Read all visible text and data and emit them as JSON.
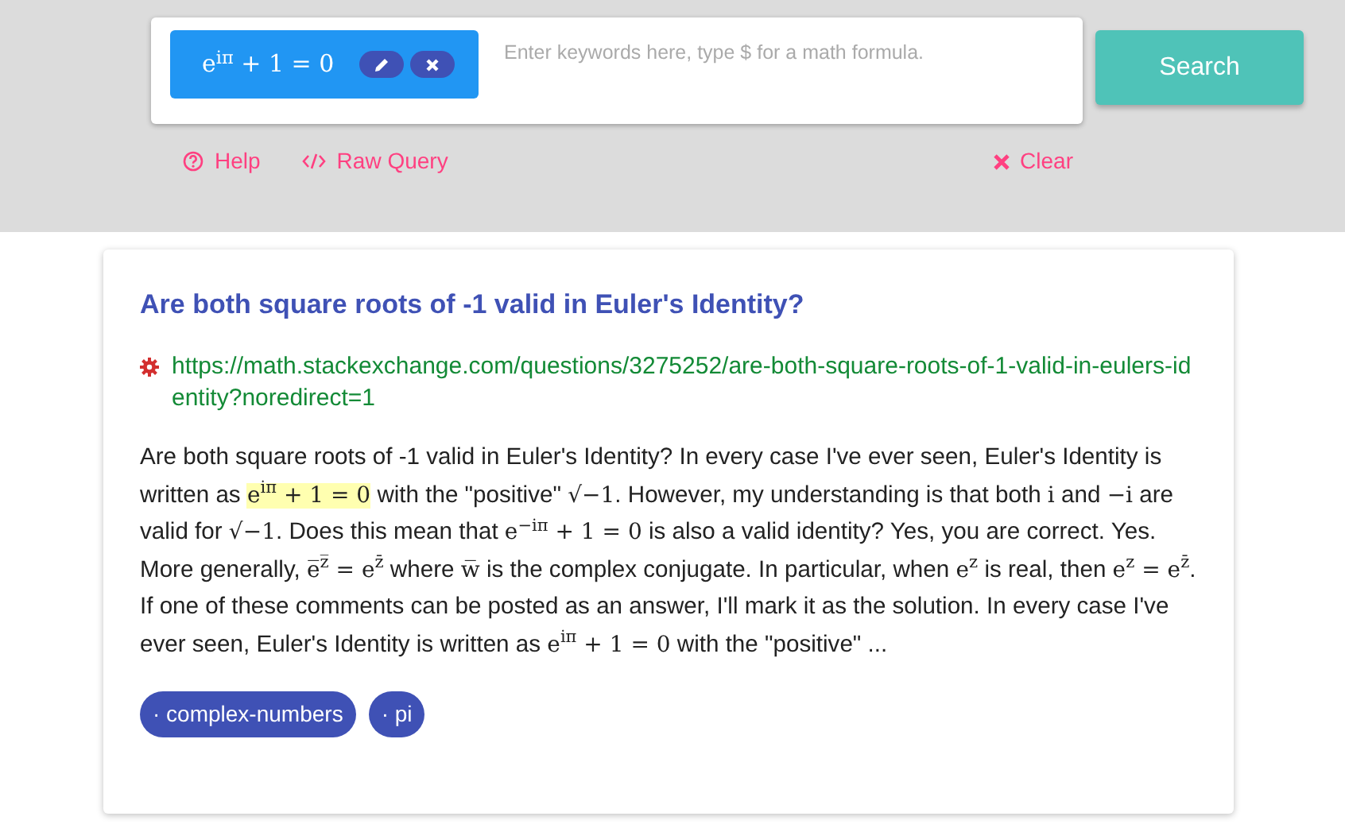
{
  "search": {
    "query_chip": {
      "formula": "e$^{iπ}$ + 1 = 0"
    },
    "placeholder": "Enter keywords here, type $ for a math formula.",
    "button": "Search"
  },
  "links": [
    {
      "kind": "help",
      "label": "Help"
    },
    {
      "kind": "raw",
      "label": "Raw Query"
    },
    {
      "kind": "clear",
      "label": "Clear"
    }
  ],
  "result": {
    "title": "Are both square roots of -1 valid in Euler's Identity?",
    "url": "https://math.stackexchange.com/questions/3275252/are-both-square-roots-of-1-valid-in-eulers-identity?noredirect=1",
    "snippet": [
      {
        "kind": "text",
        "text": "Are both square roots of -1 valid in Euler's Identity? In every case I've ever seen, Euler's Identity is written as ",
        "highlighted": false
      },
      {
        "kind": "math",
        "text": "e$^{iπ}$ + 1 = 0",
        "highlighted": true
      },
      {
        "kind": "text",
        "text": " with the \"positive\" ",
        "highlighted": false
      },
      {
        "kind": "math",
        "text": "√−1",
        "highlighted": false
      },
      {
        "kind": "text",
        "text": ". However, my understanding is that both ",
        "highlighted": false
      },
      {
        "kind": "math",
        "text": "i",
        "highlighted": false
      },
      {
        "kind": "text",
        "text": " and ",
        "highlighted": false
      },
      {
        "kind": "math",
        "text": "−i",
        "highlighted": false
      },
      {
        "kind": "text",
        "text": " are valid for ",
        "highlighted": false
      },
      {
        "kind": "math",
        "text": "√−1",
        "highlighted": false
      },
      {
        "kind": "text",
        "text": ". Does this mean that ",
        "highlighted": false
      },
      {
        "kind": "math",
        "text": "e$^{−iπ}$ + 1 = 0",
        "highlighted": false
      },
      {
        "kind": "text",
        "text": " is also a valid identity? Yes, you are correct. Yes. More generally, ",
        "highlighted": false
      },
      {
        "kind": "math",
        "text": "e̅$^{z̅}$ = e$^{z̄}$",
        "highlighted": false
      },
      {
        "kind": "text",
        "text": " where ",
        "highlighted": false
      },
      {
        "kind": "math",
        "text": "w̅",
        "highlighted": false
      },
      {
        "kind": "text",
        "text": " is the complex conjugate. In particular, when ",
        "highlighted": false
      },
      {
        "kind": "math",
        "text": "e$^{z}$",
        "highlighted": false
      },
      {
        "kind": "text",
        "text": " is real, then ",
        "highlighted": false
      },
      {
        "kind": "math",
        "text": "e$^{z}$ = e$^{z̄}$",
        "highlighted": false
      },
      {
        "kind": "text",
        "text": ". If one of these comments can be posted as an answer, I'll mark it as the solution. In every case I've ever seen, Euler's Identity is written as ",
        "highlighted": false
      },
      {
        "kind": "math",
        "text": "e$^{iπ}$ + 1 = 0",
        "highlighted": false
      },
      {
        "kind": "text",
        "text": " with the \"positive\" ...",
        "highlighted": false
      }
    ],
    "tags": [
      "· complex-numbers",
      "· pi"
    ]
  }
}
